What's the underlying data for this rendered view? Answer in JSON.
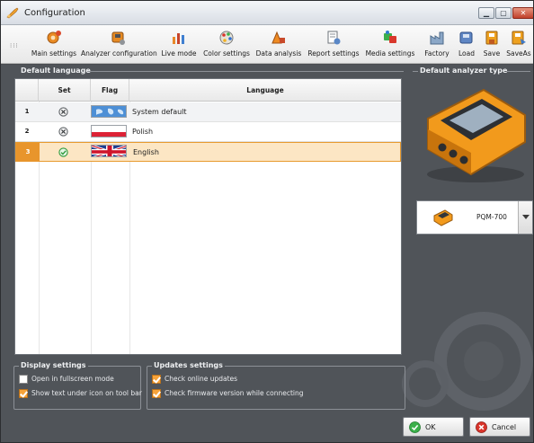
{
  "window": {
    "title": "Configuration",
    "controls": [
      "minimize",
      "maximize",
      "close"
    ]
  },
  "toolbar": {
    "items": [
      {
        "label": "Main settings",
        "icon": "main-settings-icon"
      },
      {
        "label": "Analyzer configuration",
        "icon": "analyzer-configuration-icon"
      },
      {
        "label": "Live mode",
        "icon": "live-mode-icon"
      },
      {
        "label": "Color settings",
        "icon": "color-settings-icon"
      },
      {
        "label": "Data analysis",
        "icon": "data-analysis-icon"
      },
      {
        "label": "Report settings",
        "icon": "report-settings-icon"
      },
      {
        "label": "Media settings",
        "icon": "media-settings-icon"
      },
      {
        "label": "Factory",
        "icon": "factory-icon"
      },
      {
        "label": "Load",
        "icon": "load-icon"
      },
      {
        "label": "Save",
        "icon": "save-icon"
      },
      {
        "label": "SaveAs",
        "icon": "save-as-icon"
      }
    ]
  },
  "default_language": {
    "title": "Default language",
    "columns": [
      "",
      "Set",
      "Flag",
      "Language"
    ],
    "rows": [
      {
        "num": "1",
        "set": "not-set",
        "flag": "world",
        "language": "System default"
      },
      {
        "num": "2",
        "set": "not-set",
        "flag": "poland",
        "language": "Polish"
      },
      {
        "num": "3",
        "set": "set",
        "flag": "united-kingdom",
        "language": "English",
        "selected": true
      }
    ]
  },
  "analyzer": {
    "title": "Default analyzer type",
    "selected": "PQM-700"
  },
  "display_settings": {
    "title": "Display settings",
    "options": [
      {
        "label": "Open in fullscreen mode",
        "checked": false
      },
      {
        "label": "Show text under icon on tool bar",
        "checked": true
      }
    ]
  },
  "updates_settings": {
    "title": "Updates settings",
    "options": [
      {
        "label": "Check online updates",
        "checked": true
      },
      {
        "label": "Check firmware version while connecting",
        "checked": true
      }
    ]
  },
  "buttons": {
    "ok": "OK",
    "cancel": "Cancel"
  },
  "colors": {
    "accent": "#e8952c",
    "selection": "#fce6c4",
    "panel": "#505459",
    "ok": "#3bb04a",
    "cancel": "#d9342b"
  }
}
